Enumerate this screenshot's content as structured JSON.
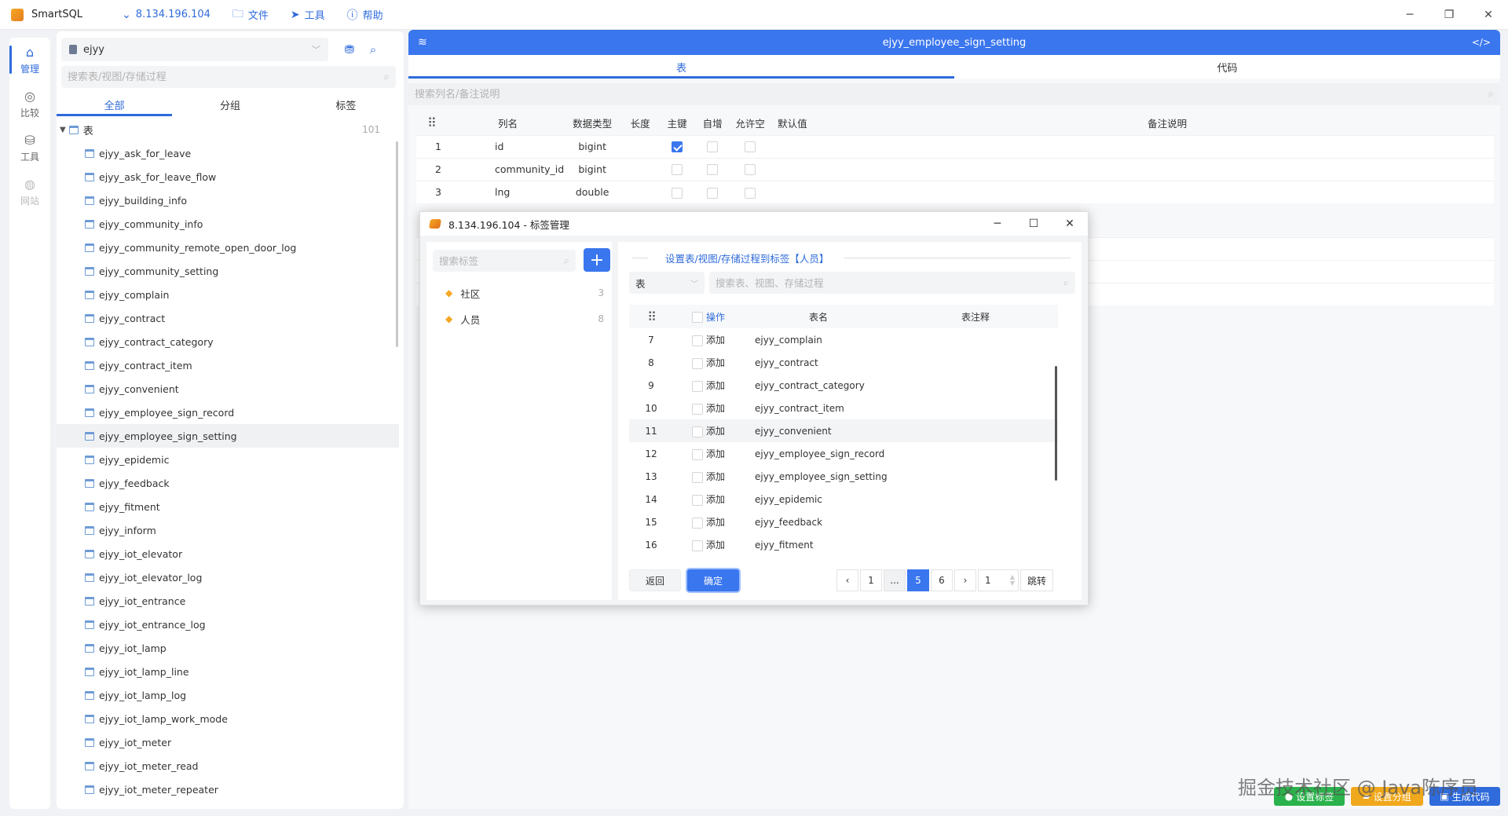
{
  "app": {
    "name": "SmartSQL",
    "connection": "8.134.196.104",
    "menu": [
      "文件",
      "工具",
      "帮助"
    ]
  },
  "rail": {
    "items": [
      {
        "label": "管理",
        "icon": "home-icon",
        "active": true
      },
      {
        "label": "比较",
        "icon": "compare-icon",
        "active": false
      },
      {
        "label": "工具",
        "icon": "toolbox-icon",
        "active": false
      },
      {
        "label": "网站",
        "icon": "globe-icon",
        "active": false,
        "disabled": true
      }
    ]
  },
  "sidebar": {
    "database": "ejyy",
    "search_placeholder": "搜索表/视图/存储过程",
    "tabs": [
      "全部",
      "分组",
      "标签"
    ],
    "active_tab": 0,
    "root_label": "表",
    "root_count": "101",
    "selected_table": "ejyy_employee_sign_setting",
    "tables": [
      "ejyy_ask_for_leave",
      "ejyy_ask_for_leave_flow",
      "ejyy_building_info",
      "ejyy_community_info",
      "ejyy_community_remote_open_door_log",
      "ejyy_community_setting",
      "ejyy_complain",
      "ejyy_contract",
      "ejyy_contract_category",
      "ejyy_contract_item",
      "ejyy_convenient",
      "ejyy_employee_sign_record",
      "ejyy_employee_sign_setting",
      "ejyy_epidemic",
      "ejyy_feedback",
      "ejyy_fitment",
      "ejyy_inform",
      "ejyy_iot_elevator",
      "ejyy_iot_elevator_log",
      "ejyy_iot_entrance",
      "ejyy_iot_entrance_log",
      "ejyy_iot_lamp",
      "ejyy_iot_lamp_line",
      "ejyy_iot_lamp_log",
      "ejyy_iot_lamp_work_mode",
      "ejyy_iot_meter",
      "ejyy_iot_meter_read",
      "ejyy_iot_meter_repeater"
    ]
  },
  "main": {
    "title": "ejyy_employee_sign_setting",
    "tabs": [
      "表",
      "代码"
    ],
    "search_placeholder": "搜索列名/备注说明",
    "columns_header": [
      "列名",
      "数据类型",
      "长度",
      "主键",
      "自增",
      "允许空",
      "默认值",
      "备注说明"
    ],
    "rows": [
      {
        "no": "1",
        "name": "id",
        "type": "bigint",
        "pk": true
      },
      {
        "no": "2",
        "name": "community_id",
        "type": "bigint",
        "pk": false
      },
      {
        "no": "3",
        "name": "lng",
        "type": "double",
        "pk": false
      }
    ]
  },
  "dialog": {
    "title": "8.134.196.104 - 标签管理",
    "tag_search_placeholder": "搜索标签",
    "tags": [
      {
        "name": "社区",
        "count": "3"
      },
      {
        "name": "人员",
        "count": "8"
      }
    ],
    "heading": "设置表/视图/存储过程到标签【人员】",
    "type_select": "表",
    "search_placeholder": "搜索表、视图、存储过程",
    "table_header": [
      "操作",
      "表名",
      "表注释"
    ],
    "rows": [
      {
        "no": "7",
        "action": "添加",
        "name": "ejyy_complain"
      },
      {
        "no": "8",
        "action": "添加",
        "name": "ejyy_contract"
      },
      {
        "no": "9",
        "action": "添加",
        "name": "ejyy_contract_category"
      },
      {
        "no": "10",
        "action": "添加",
        "name": "ejyy_contract_item"
      },
      {
        "no": "11",
        "action": "添加",
        "name": "ejyy_convenient"
      },
      {
        "no": "12",
        "action": "添加",
        "name": "ejyy_employee_sign_record"
      },
      {
        "no": "13",
        "action": "添加",
        "name": "ejyy_employee_sign_setting"
      },
      {
        "no": "14",
        "action": "添加",
        "name": "ejyy_epidemic"
      },
      {
        "no": "15",
        "action": "添加",
        "name": "ejyy_feedback"
      },
      {
        "no": "16",
        "action": "添加",
        "name": "ejyy_fitment"
      }
    ],
    "back_label": "返回",
    "ok_label": "确定",
    "pager": {
      "pages": [
        "1",
        "...",
        "5",
        "6"
      ],
      "current": "5",
      "jump_value": "1",
      "jump_label": "跳转"
    }
  },
  "bottom_buttons": [
    {
      "label": "设置标签",
      "color": "#2bb24c"
    },
    {
      "label": "设置分组",
      "color": "#f0a81c"
    },
    {
      "label": "生成代码",
      "color": "#2f6bdb"
    }
  ],
  "watermark": "掘金技术社区 @ Java陈序员",
  "colors": {
    "accent": "#3a76ee",
    "brand": "#2f6bdb"
  }
}
